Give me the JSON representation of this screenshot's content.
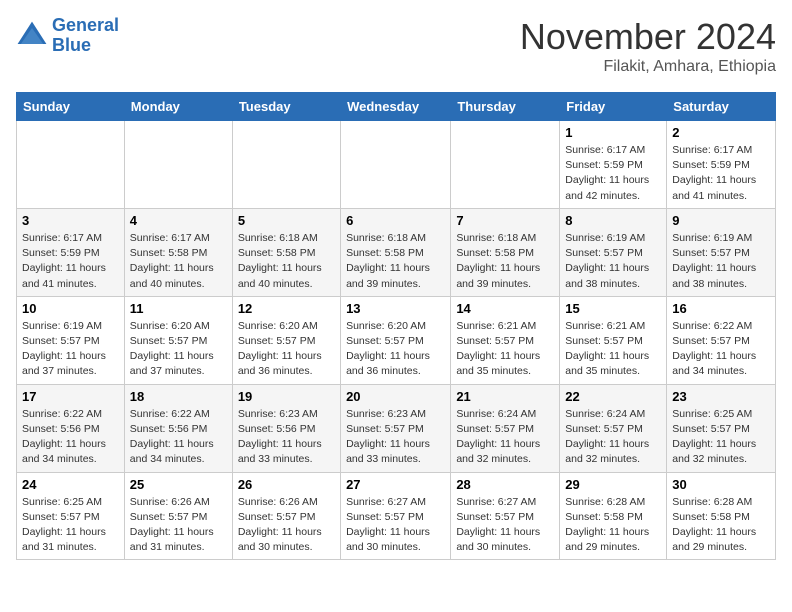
{
  "logo": {
    "line1": "General",
    "line2": "Blue"
  },
  "title": "November 2024",
  "location": "Filakit, Amhara, Ethiopia",
  "weekdays": [
    "Sunday",
    "Monday",
    "Tuesday",
    "Wednesday",
    "Thursday",
    "Friday",
    "Saturday"
  ],
  "weeks": [
    [
      {
        "day": "",
        "info": ""
      },
      {
        "day": "",
        "info": ""
      },
      {
        "day": "",
        "info": ""
      },
      {
        "day": "",
        "info": ""
      },
      {
        "day": "",
        "info": ""
      },
      {
        "day": "1",
        "info": "Sunrise: 6:17 AM\nSunset: 5:59 PM\nDaylight: 11 hours and 42 minutes."
      },
      {
        "day": "2",
        "info": "Sunrise: 6:17 AM\nSunset: 5:59 PM\nDaylight: 11 hours and 41 minutes."
      }
    ],
    [
      {
        "day": "3",
        "info": "Sunrise: 6:17 AM\nSunset: 5:59 PM\nDaylight: 11 hours and 41 minutes."
      },
      {
        "day": "4",
        "info": "Sunrise: 6:17 AM\nSunset: 5:58 PM\nDaylight: 11 hours and 40 minutes."
      },
      {
        "day": "5",
        "info": "Sunrise: 6:18 AM\nSunset: 5:58 PM\nDaylight: 11 hours and 40 minutes."
      },
      {
        "day": "6",
        "info": "Sunrise: 6:18 AM\nSunset: 5:58 PM\nDaylight: 11 hours and 39 minutes."
      },
      {
        "day": "7",
        "info": "Sunrise: 6:18 AM\nSunset: 5:58 PM\nDaylight: 11 hours and 39 minutes."
      },
      {
        "day": "8",
        "info": "Sunrise: 6:19 AM\nSunset: 5:57 PM\nDaylight: 11 hours and 38 minutes."
      },
      {
        "day": "9",
        "info": "Sunrise: 6:19 AM\nSunset: 5:57 PM\nDaylight: 11 hours and 38 minutes."
      }
    ],
    [
      {
        "day": "10",
        "info": "Sunrise: 6:19 AM\nSunset: 5:57 PM\nDaylight: 11 hours and 37 minutes."
      },
      {
        "day": "11",
        "info": "Sunrise: 6:20 AM\nSunset: 5:57 PM\nDaylight: 11 hours and 37 minutes."
      },
      {
        "day": "12",
        "info": "Sunrise: 6:20 AM\nSunset: 5:57 PM\nDaylight: 11 hours and 36 minutes."
      },
      {
        "day": "13",
        "info": "Sunrise: 6:20 AM\nSunset: 5:57 PM\nDaylight: 11 hours and 36 minutes."
      },
      {
        "day": "14",
        "info": "Sunrise: 6:21 AM\nSunset: 5:57 PM\nDaylight: 11 hours and 35 minutes."
      },
      {
        "day": "15",
        "info": "Sunrise: 6:21 AM\nSunset: 5:57 PM\nDaylight: 11 hours and 35 minutes."
      },
      {
        "day": "16",
        "info": "Sunrise: 6:22 AM\nSunset: 5:57 PM\nDaylight: 11 hours and 34 minutes."
      }
    ],
    [
      {
        "day": "17",
        "info": "Sunrise: 6:22 AM\nSunset: 5:56 PM\nDaylight: 11 hours and 34 minutes."
      },
      {
        "day": "18",
        "info": "Sunrise: 6:22 AM\nSunset: 5:56 PM\nDaylight: 11 hours and 34 minutes."
      },
      {
        "day": "19",
        "info": "Sunrise: 6:23 AM\nSunset: 5:56 PM\nDaylight: 11 hours and 33 minutes."
      },
      {
        "day": "20",
        "info": "Sunrise: 6:23 AM\nSunset: 5:57 PM\nDaylight: 11 hours and 33 minutes."
      },
      {
        "day": "21",
        "info": "Sunrise: 6:24 AM\nSunset: 5:57 PM\nDaylight: 11 hours and 32 minutes."
      },
      {
        "day": "22",
        "info": "Sunrise: 6:24 AM\nSunset: 5:57 PM\nDaylight: 11 hours and 32 minutes."
      },
      {
        "day": "23",
        "info": "Sunrise: 6:25 AM\nSunset: 5:57 PM\nDaylight: 11 hours and 32 minutes."
      }
    ],
    [
      {
        "day": "24",
        "info": "Sunrise: 6:25 AM\nSunset: 5:57 PM\nDaylight: 11 hours and 31 minutes."
      },
      {
        "day": "25",
        "info": "Sunrise: 6:26 AM\nSunset: 5:57 PM\nDaylight: 11 hours and 31 minutes."
      },
      {
        "day": "26",
        "info": "Sunrise: 6:26 AM\nSunset: 5:57 PM\nDaylight: 11 hours and 30 minutes."
      },
      {
        "day": "27",
        "info": "Sunrise: 6:27 AM\nSunset: 5:57 PM\nDaylight: 11 hours and 30 minutes."
      },
      {
        "day": "28",
        "info": "Sunrise: 6:27 AM\nSunset: 5:57 PM\nDaylight: 11 hours and 30 minutes."
      },
      {
        "day": "29",
        "info": "Sunrise: 6:28 AM\nSunset: 5:58 PM\nDaylight: 11 hours and 29 minutes."
      },
      {
        "day": "30",
        "info": "Sunrise: 6:28 AM\nSunset: 5:58 PM\nDaylight: 11 hours and 29 minutes."
      }
    ]
  ]
}
